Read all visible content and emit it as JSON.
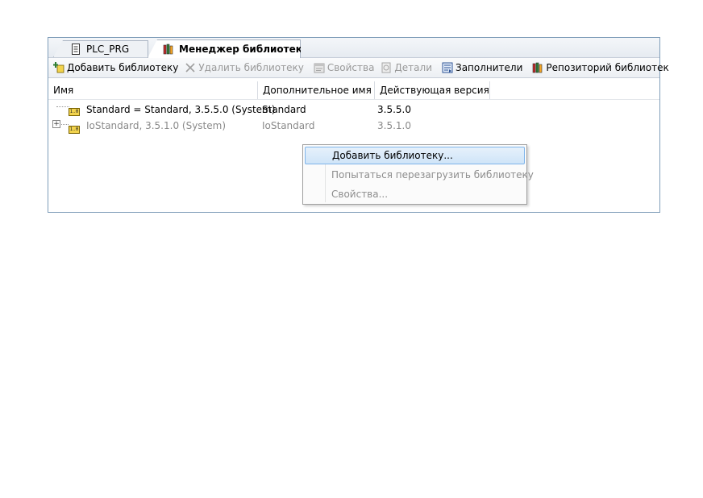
{
  "tabs": [
    {
      "label": "PLC_PRG",
      "active": false
    },
    {
      "label": "Менеджер библиотек",
      "active": true,
      "closable": true
    }
  ],
  "toolbar": {
    "add_library": "Добавить библиотеку",
    "remove_library": "Удалить библиотеку",
    "properties": "Свойства",
    "details": "Детали",
    "placeholders": "Заполнители",
    "library_repository": "Репозиторий библиотек"
  },
  "table": {
    "columns": [
      "Имя",
      "Дополнительное имя",
      "Действующая версия"
    ],
    "rows": [
      {
        "name": "Standard = Standard, 3.5.5.0 (System)",
        "alt_name": "Standard",
        "version": "3.5.5.0",
        "expandable": false,
        "greyed": false
      },
      {
        "name": "IoStandard, 3.5.1.0 (System)",
        "alt_name": "IoStandard",
        "version": "3.5.1.0",
        "expandable": true,
        "greyed": true
      }
    ]
  },
  "context_menu": {
    "items": [
      {
        "label": "Добавить библиотеку...",
        "highlighted": true,
        "enabled": true
      },
      {
        "label": "Попытаться перезагрузить библиотеку",
        "highlighted": false,
        "enabled": false
      },
      {
        "label": "Свойства...",
        "highlighted": false,
        "enabled": false
      }
    ]
  },
  "icons": {
    "plc_prg_tab": "document-icon",
    "library_manager_tab": "books-icon",
    "close": "close-icon",
    "add": "add-library-icon",
    "remove": "remove-x-icon",
    "properties": "properties-icon",
    "details": "details-icon",
    "placeholders": "placeholders-icon",
    "repository": "books-icon",
    "library_item": "library-icon",
    "expand": "plus-expand-icon"
  },
  "colors": {
    "frame_border": "#7f9db9",
    "menu_highlight": "#cfe4f8",
    "menu_highlight_border": "#7eb4ea",
    "disabled_text": "#8d8d8d"
  }
}
